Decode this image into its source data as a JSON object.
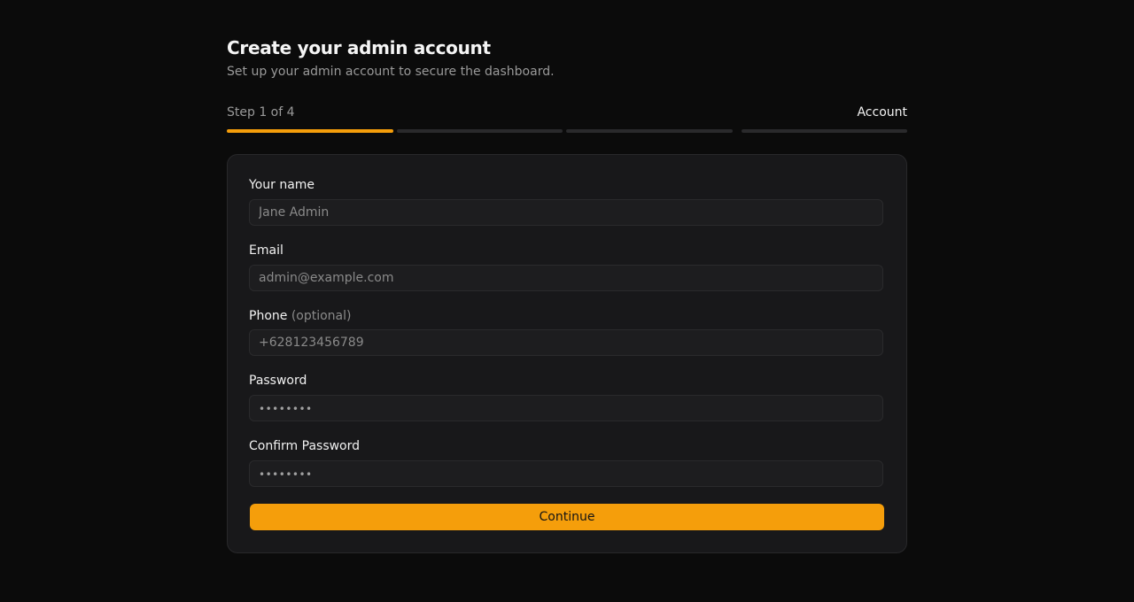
{
  "header": {
    "title": "Create your admin account",
    "subtitle": "Set up your admin account to secure the dashboard."
  },
  "steps": {
    "label": "Step 1 of 4",
    "current_name": "Account",
    "total": 4,
    "current": 1
  },
  "form": {
    "name": {
      "label": "Your name",
      "placeholder": "Jane Admin",
      "value": ""
    },
    "email": {
      "label": "Email",
      "placeholder": "admin@example.com",
      "value": ""
    },
    "phone": {
      "label": "Phone",
      "optional": "(optional)",
      "placeholder": "+628123456789",
      "value": ""
    },
    "password": {
      "label": "Password",
      "masked": "••••••••"
    },
    "confirm_password": {
      "label": "Confirm Password",
      "masked": "••••••••"
    },
    "submit_label": "Continue"
  },
  "colors": {
    "accent": "#f59e0b",
    "background": "#0b0b0b",
    "card": "#18181a"
  }
}
